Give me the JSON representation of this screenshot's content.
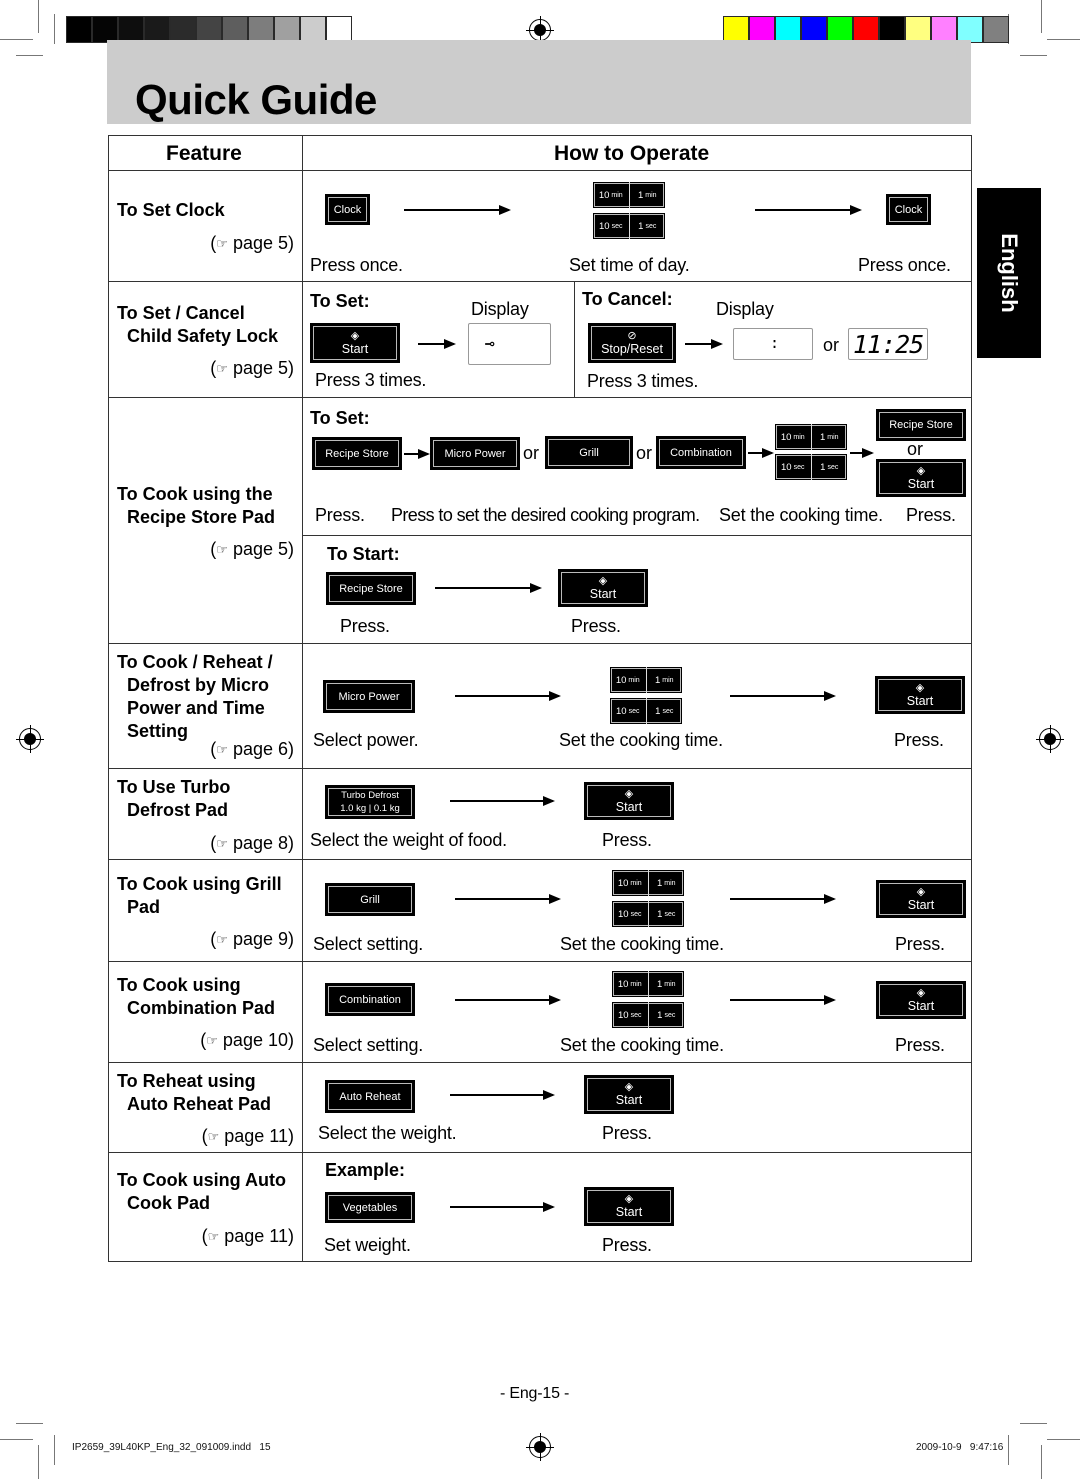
{
  "header": {
    "title": "Quick Guide",
    "language_tab": "English",
    "grayscale_swatches": [
      "#000000",
      "#050505",
      "#0e0e0e",
      "#1a1a1a",
      "#2b2b2b",
      "#444444",
      "#5e5e5e",
      "#7d7d7d",
      "#a0a0a0",
      "#cccccc",
      "#ffffff"
    ],
    "color_swatches": [
      "#ffff00",
      "#ff00ff",
      "#00ffff",
      "#0000ff",
      "#00ff00",
      "#ff0000",
      "#000000",
      "#ffff80",
      "#ff80ff",
      "#80ffff",
      "#808080"
    ]
  },
  "table": {
    "col_feature": "Feature",
    "col_operate": "How to Operate"
  },
  "keys": {
    "clock": "Clock",
    "start": "Start",
    "stop_reset": "Stop/Reset",
    "recipe_store": "Recipe Store",
    "micro_power": "Micro Power",
    "grill": "Grill",
    "combination": "Combination",
    "auto_reheat": "Auto Reheat",
    "vegetables": "Vegetables",
    "turbo_defrost_title": "Turbo Defrost",
    "turbo_1kg": "1.0 kg",
    "turbo_01kg": "0.1 kg",
    "t10min": "10",
    "t1min": "1",
    "t10sec": "10",
    "t1sec": "1",
    "min": "min",
    "sec": "sec",
    "start_icon": "◈",
    "stop_icon": "⊘"
  },
  "words": {
    "or": "or",
    "display": "Display",
    "to_set": "To Set:",
    "to_cancel": "To Cancel:",
    "to_start": "To Start:",
    "example": "Example:",
    "lock_symbol": "⊸",
    "display_blank": ":",
    "display_time": "11:25"
  },
  "rows": [
    {
      "feature_l1": "To Set Clock",
      "feature_l2": "",
      "page": "page 5",
      "captions": [
        "Press once.",
        "Set time of day.",
        "Press once."
      ]
    },
    {
      "feature_l1": "To Set / Cancel",
      "feature_l2": "Child Safety Lock",
      "page": "page 5",
      "captions": [
        "Press 3 times.",
        "Press 3 times."
      ]
    },
    {
      "feature_l1": "To Cook using the",
      "feature_l2": "Recipe Store Pad",
      "page": "page 5",
      "captions": [
        "Press.",
        "Press to set the desired cooking program.",
        "Set the cooking time.",
        "Press.",
        "Press.",
        "Press."
      ]
    },
    {
      "feature_l1": "To Cook / Reheat /",
      "feature_l2": "Defrost by Micro",
      "feature_l3": "Power and Time",
      "feature_l4": "Setting",
      "page": "page 6",
      "captions": [
        "Select power.",
        "Set the cooking time.",
        "Press."
      ]
    },
    {
      "feature_l1": "To Use Turbo",
      "feature_l2": "Defrost Pad",
      "page": "page 8",
      "captions": [
        "Select the weight of food.",
        "Press."
      ]
    },
    {
      "feature_l1": "To Cook using Grill",
      "feature_l2": "Pad",
      "page": "page 9",
      "captions": [
        "Select setting.",
        "Set the cooking time.",
        "Press."
      ]
    },
    {
      "feature_l1": "To Cook using",
      "feature_l2": "Combination Pad",
      "page": "page 10",
      "captions": [
        "Select setting.",
        "Set the cooking time.",
        "Press."
      ]
    },
    {
      "feature_l1": "To Reheat using",
      "feature_l2": "Auto Reheat Pad",
      "page": "page 11",
      "captions": [
        "Select the weight.",
        "Press."
      ]
    },
    {
      "feature_l1": "To Cook using Auto",
      "feature_l2": "Cook Pad",
      "page": "page 11",
      "captions": [
        "Set weight.",
        "Press."
      ]
    }
  ],
  "footer": {
    "page_number": "- Eng-15 -",
    "file_info": "IP2659_39L40KP_Eng_32_091009.indd   15",
    "timestamp": "2009-10-9   9:47:16",
    "hand_icon": "☞"
  }
}
